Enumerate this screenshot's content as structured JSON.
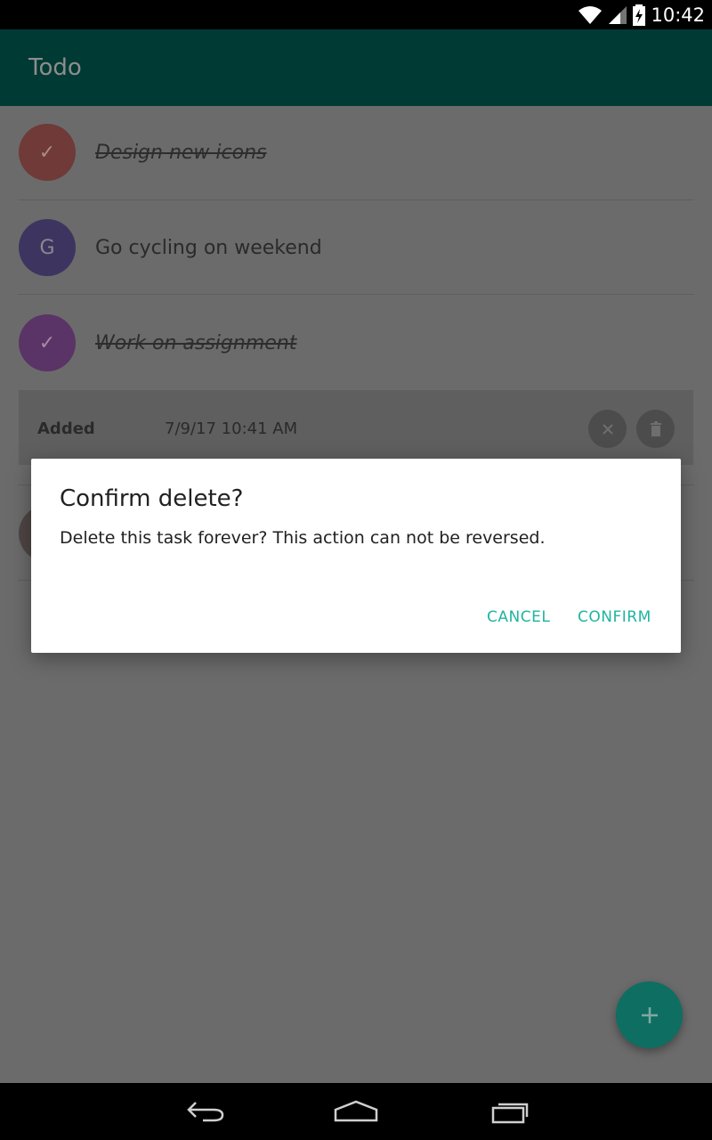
{
  "status_bar": {
    "time": "10:42"
  },
  "app_bar": {
    "title": "Todo"
  },
  "tasks": [
    {
      "title": "Design new icons",
      "avatar_text": "✓",
      "completed": true,
      "avatar_color": "#6f3a37"
    },
    {
      "title": "Go cycling on weekend",
      "avatar_text": "G",
      "completed": false,
      "avatar_color": "#3d3560"
    },
    {
      "title": "Work on assignment",
      "avatar_text": "✓",
      "completed": true,
      "avatar_color": "#5a3466"
    }
  ],
  "detail": {
    "label": "Added",
    "value": "7/9/17 10:41 AM"
  },
  "dialog": {
    "title": "Confirm delete?",
    "message": "Delete this task forever? This action can not be reversed.",
    "cancel_label": "CANCEL",
    "confirm_label": "CONFIRM"
  },
  "fab": {
    "icon": "plus-icon"
  },
  "colors": {
    "accent": "#1fb5a0",
    "primary_dark": "#003a34",
    "scrim": "#6b6b6b"
  }
}
